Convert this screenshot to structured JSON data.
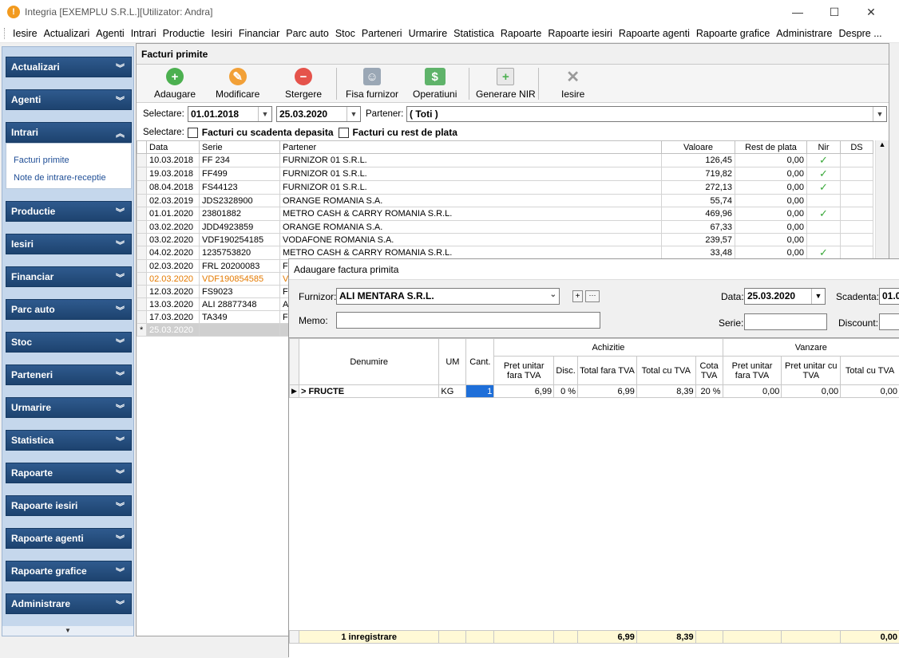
{
  "window": {
    "title": "Integria [EXEMPLU S.R.L.][Utilizator: Andra]",
    "minimize": "—",
    "maximize": "☐",
    "close": "✕"
  },
  "menu": [
    "Iesire",
    "Actualizari",
    "Agenti",
    "Intrari",
    "Productie",
    "Iesiri",
    "Financiar",
    "Parc auto",
    "Stoc",
    "Parteneri",
    "Urmarire",
    "Statistica",
    "Rapoarte",
    "Rapoarte iesiri",
    "Rapoarte agenti",
    "Rapoarte grafice",
    "Administrare",
    "Despre ..."
  ],
  "sidebar": {
    "groups": [
      "Actualizari",
      "Agenti",
      "Intrari",
      "Productie",
      "Iesiri",
      "Financiar",
      "Parc auto",
      "Stoc",
      "Parteneri",
      "Urmarire",
      "Statistica",
      "Rapoarte",
      "Rapoarte iesiri",
      "Rapoarte agenti",
      "Rapoarte grafice",
      "Administrare"
    ],
    "intrari_links": [
      "Facturi primite",
      "Note de intrare-receptie"
    ]
  },
  "panel": {
    "title": "Facturi primite"
  },
  "toolbar": {
    "add": "Adaugare",
    "edit": "Modificare",
    "delete": "Stergere",
    "supplier_sheet": "Fisa furnizor",
    "operations": "Operatiuni",
    "nir": "Generare NIR",
    "exit": "Iesire"
  },
  "filters": {
    "select_label": "Selectare:",
    "date_from": "01.01.2018",
    "date_to": "25.03.2020",
    "partner_label": "Partener:",
    "partner_value": "( Toti )",
    "select_label2": "Selectare:",
    "overdue": "Facturi cu scadenta depasita",
    "remaining": "Facturi cu rest de plata"
  },
  "grid": {
    "headers": [
      "Data",
      "Serie",
      "Partener",
      "Valoare",
      "Rest de plata",
      "Nir",
      "DS"
    ],
    "rows": [
      [
        "10.03.2018",
        "FF 234",
        "FURNIZOR 01 S.R.L.",
        "126,45",
        "0,00",
        "✓"
      ],
      [
        "19.03.2018",
        "FF499",
        "FURNIZOR 01 S.R.L.",
        "719,82",
        "0,00",
        "✓"
      ],
      [
        "08.04.2018",
        "FS44123",
        "FURNIZOR 01 S.R.L.",
        "272,13",
        "0,00",
        "✓"
      ],
      [
        "02.03.2019",
        "JDS2328900",
        "ORANGE ROMANIA S.A.",
        "55,74",
        "0,00",
        ""
      ],
      [
        "01.01.2020",
        "23801882",
        "METRO CASH & CARRY ROMANIA S.R.L.",
        "469,96",
        "0,00",
        "✓"
      ],
      [
        "03.02.2020",
        "JDD4923859",
        "ORANGE ROMANIA S.A.",
        "67,33",
        "0,00",
        ""
      ],
      [
        "03.02.2020",
        "VDF190254185",
        "VODAFONE ROMANIA S.A.",
        "239,57",
        "0,00",
        ""
      ],
      [
        "04.02.2020",
        "1235753820",
        "METRO CASH & CARRY ROMANIA S.R.L.",
        "33,48",
        "0,00",
        "✓"
      ],
      [
        "02.03.2020",
        "FRL 20200083",
        "F",
        "",
        "",
        ""
      ],
      [
        "02.03.2020",
        "VDF190854585",
        "V",
        "",
        "",
        ""
      ],
      [
        "12.03.2020",
        "FS9023",
        "F",
        "",
        "",
        ""
      ],
      [
        "13.03.2020",
        "ALI 28877348",
        "A",
        "",
        "",
        ""
      ],
      [
        "17.03.2020",
        "TA349",
        "F",
        "",
        "",
        ""
      ]
    ],
    "new_row_date": "25.03.2020"
  },
  "dialog": {
    "title": "Adaugare factura primita",
    "supplier_label": "Furnizor:",
    "supplier": "ALI MENTARA S.R.L.",
    "memo_label": "Memo:",
    "memo": "",
    "date_label": "Data:",
    "date": "25.03.2020",
    "due_label": "Scadenta:",
    "due": "01.0",
    "series_label": "Serie:",
    "series": "",
    "discount_label": "Discount:",
    "discount": "",
    "headers": {
      "name": "Denumire",
      "um": "UM",
      "qty": "Cant.",
      "purchase": "Achizitie",
      "sale": "Vanzare",
      "unit_no_vat": "Pret unitar fara TVA",
      "disc": "Disc.",
      "total_no_vat": "Total fara TVA",
      "total_vat": "Total cu TVA",
      "vat_rate": "Cota TVA",
      "sale_unit_no_vat": "Pret unitar fara TVA",
      "sale_unit_vat": "Pret unitar cu TVA",
      "sale_total_vat": "Total cu TVA"
    },
    "row": {
      "name": "> FRUCTE",
      "um": "KG",
      "qty": "1",
      "unit": "6,99",
      "disc": "0 %",
      "total_no_vat": "6,99",
      "total_vat": "8,39",
      "vat": "20 %",
      "s1": "0,00",
      "s2": "0,00",
      "s3": "0,00"
    },
    "footer": {
      "count": "1 inregistrare",
      "total_no_vat": "6,99",
      "total_vat": "8,39",
      "sale_total": "0,00"
    }
  }
}
